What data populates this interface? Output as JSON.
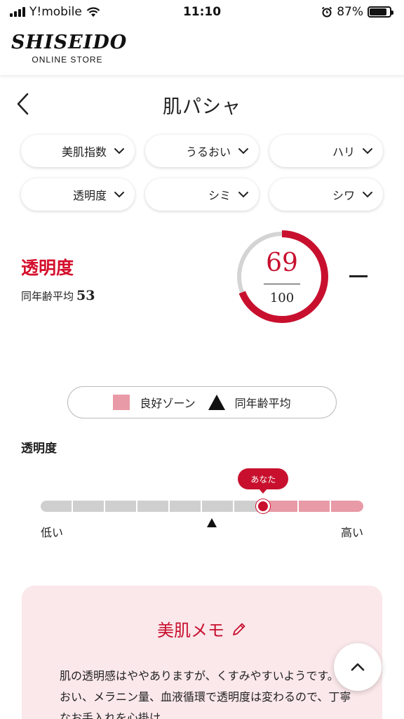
{
  "status_bar": {
    "carrier": "Y!mobile",
    "time": "11:10",
    "battery": "87%",
    "battery_level": 0.87
  },
  "header": {
    "logo_main": "SHISEIDO",
    "logo_sub": "ONLINE STORE"
  },
  "title_bar": {
    "title": "肌パシャ",
    "back_icon": "chevron-left-icon"
  },
  "filters": [
    "美肌指数",
    "うるおい",
    "ハリ",
    "透明度",
    "シミ",
    "シワ"
  ],
  "score": {
    "metric": "透明度",
    "avg_label": "同年齢平均",
    "avg_value": "53",
    "value": "69",
    "max": "100",
    "accent": "#c8102e"
  },
  "legend": {
    "good_zone": "良好ゾーン",
    "average": "同年齢平均",
    "good_color": "#e89aa6"
  },
  "scale": {
    "title": "透明度",
    "you_label": "あなた",
    "low": "低い",
    "high": "高い",
    "segments": 10,
    "good_from": 7,
    "you_position": 0.69,
    "avg_position": 0.53
  },
  "memo": {
    "title": "美肌メモ",
    "body": "肌の透明感はややありますが、くすみやすいようです。うるおい、メラニン量、血液循環で透明度は変わるので、丁寧なお手入れを心掛け"
  }
}
